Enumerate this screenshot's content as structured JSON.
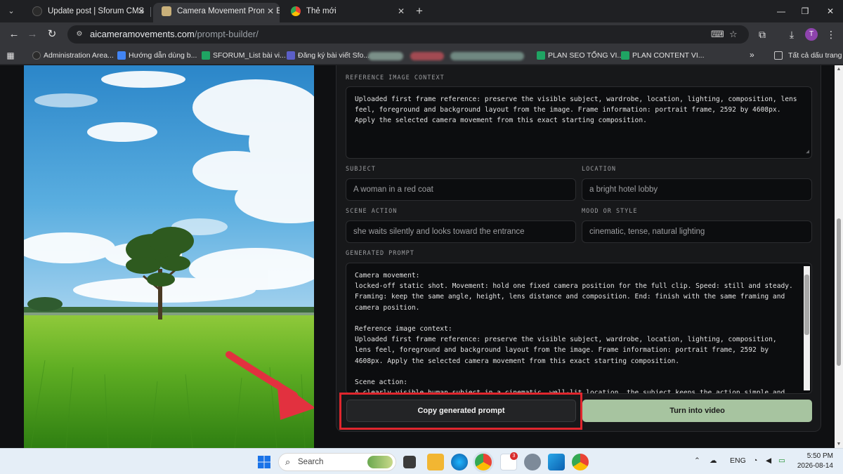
{
  "browser": {
    "tabs": [
      {
        "title": "Update post | Sforum CMS",
        "active": false
      },
      {
        "title": "Camera Movement Prompt Buil",
        "active": true
      },
      {
        "title": "Thẻ mới",
        "active": false
      }
    ],
    "url": {
      "host": "aicameramovements.com",
      "path": "/prompt-builder/"
    },
    "profile_initial": "T",
    "bookmarks": [
      "Administration Area...",
      "Hướng dẫn dùng b...",
      "SFORUM_List bài vi...",
      "Đăng ký bài viết Sfo...",
      "PLAN SEO TỔNG VI...",
      "PLAN CONTENT VI..."
    ],
    "all_bookmarks": "Tất cả dấu trang"
  },
  "form": {
    "reference": {
      "label": "REFERENCE IMAGE CONTEXT",
      "value": "Uploaded first frame reference: preserve the visible subject, wardrobe, location, lighting, composition, lens feel, foreground and background layout from the image. Frame information: portrait frame, 2592 by 4608px. Apply the selected camera movement from this exact starting composition."
    },
    "subject": {
      "label": "SUBJECT",
      "placeholder": "A woman in a red coat"
    },
    "location": {
      "label": "LOCATION",
      "placeholder": "a bright hotel lobby"
    },
    "scene_action": {
      "label": "SCENE ACTION",
      "placeholder": "she waits silently and looks toward the entrance"
    },
    "mood": {
      "label": "MOOD OR STYLE",
      "placeholder": "cinematic, tense, natural lighting"
    },
    "generated": {
      "label": "GENERATED PROMPT",
      "value": "Camera movement:\nlocked-off static shot. Movement: hold one fixed camera position for the full clip. Speed: still and steady. Framing: keep the same angle, height, lens distance and composition. End: finish with the same framing and camera position.\n\nReference image context:\nUploaded first frame reference: preserve the visible subject, wardrobe, location, lighting, composition, lens feel, foreground and background layout from the image. Frame information: portrait frame, 2592 by 4608px. Apply the selected camera movement from this exact starting composition.\n\nScene action:\nA clearly visible human subject in a cinematic, well-lit location, the subject keeps the action simple and"
    },
    "copy_button": "Copy generated prompt",
    "video_button": "Turn into video"
  },
  "taskbar": {
    "search_placeholder": "Search",
    "zalo_badge": "3",
    "language": "ENG",
    "time": "5:50 PM",
    "date": "2026-08-14"
  },
  "colors": {
    "accent_green": "#a7c4a0",
    "highlight_red": "#e0262d",
    "arrow_red": "#e2313f"
  }
}
